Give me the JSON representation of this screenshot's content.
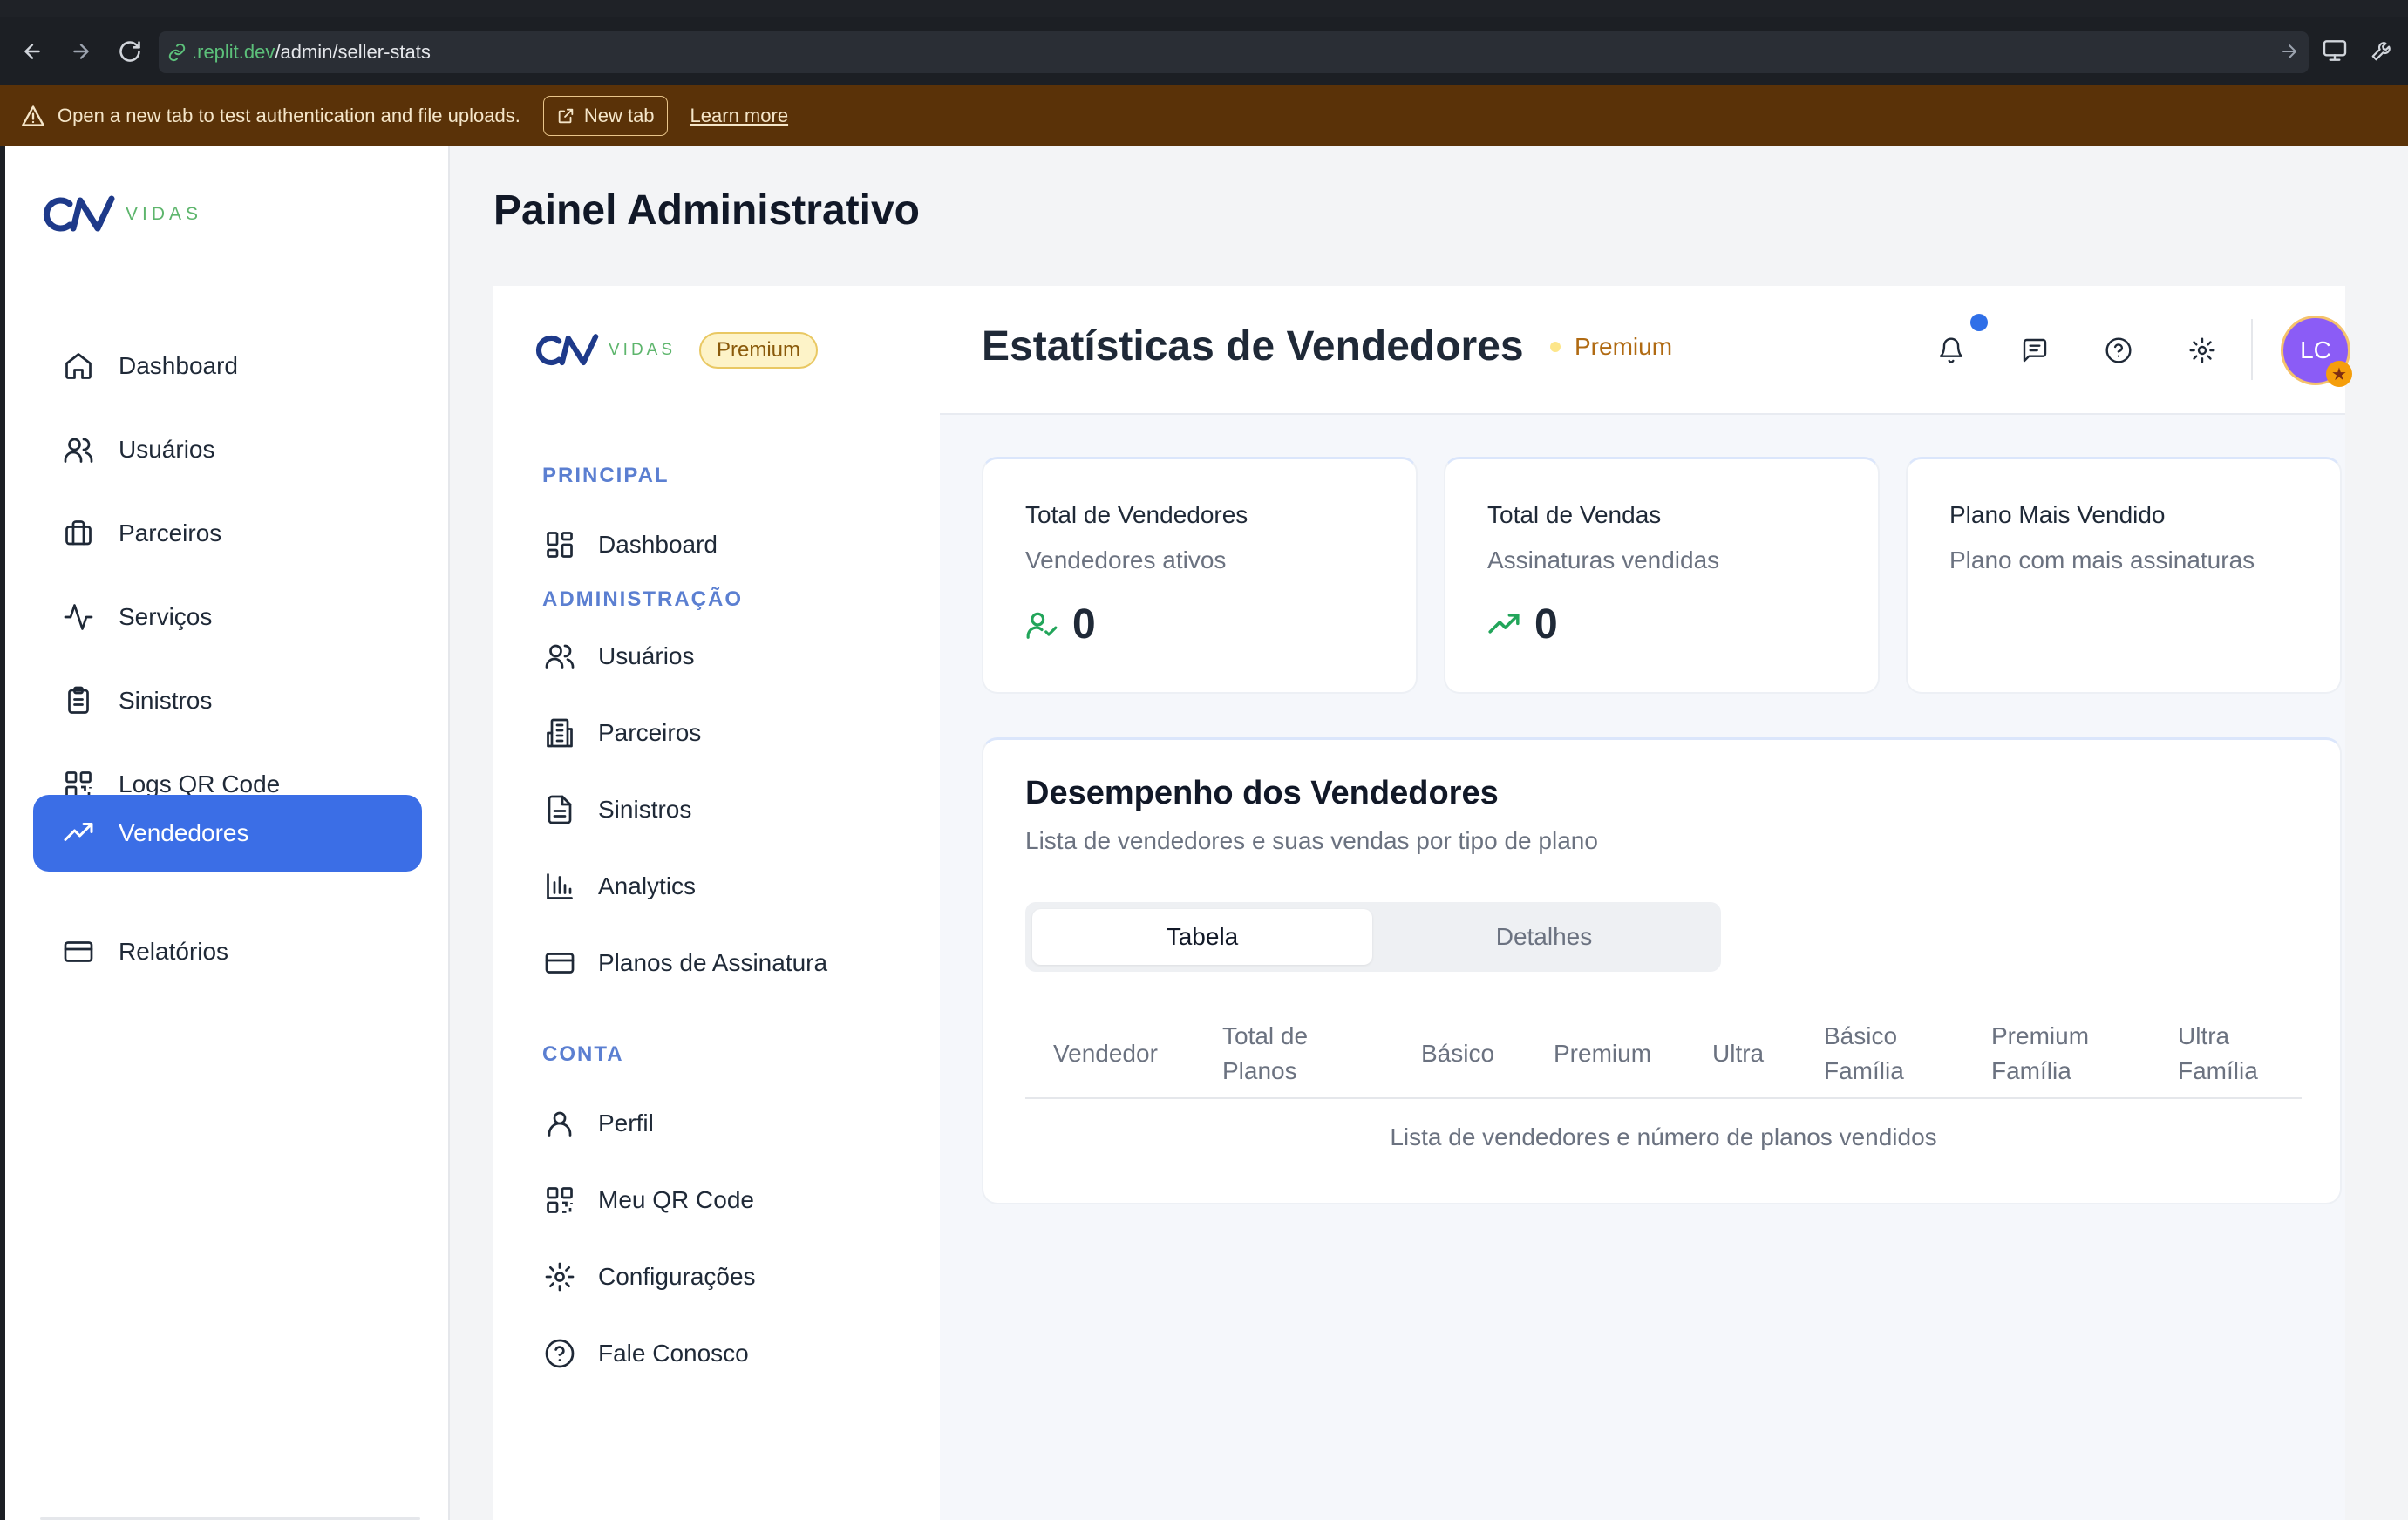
{
  "browser": {
    "url_host": ".replit.dev",
    "url_path": "/admin/seller-stats",
    "banner_text": "Open a new tab to test authentication and file uploads.",
    "banner_button": "New tab",
    "banner_link": "Learn more"
  },
  "brand": {
    "wordmark": "VIDAS",
    "logo_colors": {
      "cn": "#1e3a8a",
      "accent": "#5db56c"
    }
  },
  "outer_sidebar": {
    "items": [
      {
        "label": "Dashboard",
        "icon": "home-icon"
      },
      {
        "label": "Usuários",
        "icon": "users-icon"
      },
      {
        "label": "Parceiros",
        "icon": "briefcase-icon"
      },
      {
        "label": "Serviços",
        "icon": "activity-icon"
      },
      {
        "label": "Sinistros",
        "icon": "clipboard-icon"
      },
      {
        "label": "Logs QR Code",
        "icon": "qr-code-icon"
      },
      {
        "label": "Vendedores",
        "icon": "trending-up-icon",
        "active": true
      },
      {
        "label": "Relatórios",
        "icon": "credit-card-icon"
      }
    ],
    "active_color": "#3b6ee6"
  },
  "page_title": "Painel Administrativo",
  "inner_sidebar": {
    "badge": "Premium",
    "sections": {
      "principal": "PRINCIPAL",
      "administracao": "ADMINISTRAÇÃO",
      "conta": "CONTA"
    },
    "principal_items": [
      {
        "label": "Dashboard",
        "icon": "layout-grid-icon"
      }
    ],
    "admin_items": [
      {
        "label": "Usuários",
        "icon": "users-icon"
      },
      {
        "label": "Parceiros",
        "icon": "building-icon"
      },
      {
        "label": "Sinistros",
        "icon": "file-text-icon"
      },
      {
        "label": "Analytics",
        "icon": "bar-chart-icon"
      },
      {
        "label": "Planos de Assinatura",
        "icon": "credit-card-icon"
      }
    ],
    "account_items": [
      {
        "label": "Perfil",
        "icon": "user-icon"
      },
      {
        "label": "Meu QR Code",
        "icon": "qr-code-icon"
      },
      {
        "label": "Configurações",
        "icon": "settings-icon"
      },
      {
        "label": "Fale Conosco",
        "icon": "help-circle-icon"
      }
    ]
  },
  "header": {
    "title": "Estatísticas de Vendedores",
    "tier": "Premium",
    "avatar_initials": "LC",
    "avatar_color": "#8b5cf6"
  },
  "stats": [
    {
      "title": "Total de Vendedores",
      "subtitle": "Vendedores ativos",
      "value": "0",
      "icon": "user-check-icon"
    },
    {
      "title": "Total de Vendas",
      "subtitle": "Assinaturas vendidas",
      "value": "0",
      "icon": "trending-up-icon"
    },
    {
      "title": "Plano Mais Vendido",
      "subtitle": "Plano com mais assinaturas"
    }
  ],
  "performance": {
    "title": "Desempenho dos Vendedores",
    "subtitle": "Lista de vendedores e suas vendas por tipo de plano",
    "tabs": [
      "Tabela",
      "Detalhes"
    ],
    "active_tab": "Tabela",
    "columns": [
      [
        "Vendedor"
      ],
      [
        "Total de",
        "Planos"
      ],
      [
        "Básico"
      ],
      [
        "Premium"
      ],
      [
        "Ultra"
      ],
      [
        "Básico",
        "Família"
      ],
      [
        "Premium",
        "Família"
      ],
      [
        "Ultra",
        "Família"
      ]
    ],
    "caption": "Lista de vendedores e número de planos vendidos"
  }
}
